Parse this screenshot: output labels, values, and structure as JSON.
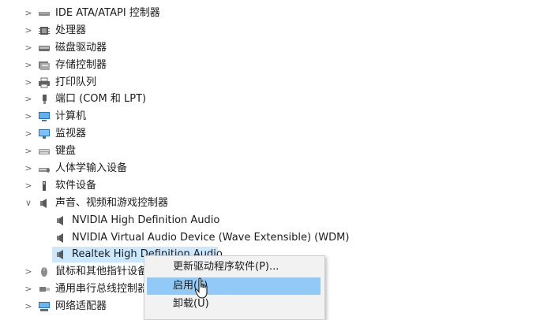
{
  "tree": {
    "items": [
      {
        "label": "IDE ATA/ATAPI 控制器",
        "chevron": ">",
        "icon": "ide-controller-icon",
        "level": 0
      },
      {
        "label": "处理器",
        "chevron": ">",
        "icon": "processor-icon",
        "level": 0
      },
      {
        "label": "磁盘驱动器",
        "chevron": ">",
        "icon": "disk-drive-icon",
        "level": 0
      },
      {
        "label": "存储控制器",
        "chevron": ">",
        "icon": "storage-controller-icon",
        "level": 0
      },
      {
        "label": "打印队列",
        "chevron": ">",
        "icon": "printer-icon",
        "level": 0
      },
      {
        "label": "端口 (COM 和 LPT)",
        "chevron": ">",
        "icon": "port-icon",
        "level": 0
      },
      {
        "label": "计算机",
        "chevron": ">",
        "icon": "computer-icon",
        "level": 0
      },
      {
        "label": "监视器",
        "chevron": ">",
        "icon": "monitor-icon",
        "level": 0
      },
      {
        "label": "键盘",
        "chevron": ">",
        "icon": "keyboard-icon",
        "level": 0
      },
      {
        "label": "人体学输入设备",
        "chevron": ">",
        "icon": "hid-icon",
        "level": 0
      },
      {
        "label": "软件设备",
        "chevron": ">",
        "icon": "software-device-icon",
        "level": 0
      },
      {
        "label": "声音、视频和游戏控制器",
        "chevron": "∨",
        "icon": "speaker-icon",
        "level": 0
      },
      {
        "label": "NVIDIA High Definition Audio",
        "chevron": "",
        "icon": "speaker-icon",
        "level": 1
      },
      {
        "label": "NVIDIA Virtual Audio Device (Wave Extensible) (WDM)",
        "chevron": "",
        "icon": "speaker-icon",
        "level": 1
      },
      {
        "label": "Realtek High Definition Audio",
        "chevron": "",
        "icon": "speaker-icon",
        "level": 1,
        "selected": true
      },
      {
        "label": "鼠标和其他指针设备",
        "chevron": ">",
        "icon": "mouse-icon",
        "level": 0
      },
      {
        "label": "通用串行总线控制器",
        "chevron": ">",
        "icon": "usb-icon",
        "level": 0
      },
      {
        "label": "网络适配器",
        "chevron": ">",
        "icon": "network-adapter-icon",
        "level": 0
      }
    ]
  },
  "context_menu": {
    "items": [
      {
        "label": "更新驱动程序软件(P)..."
      },
      {
        "label": "启用(E)",
        "highlighted": true
      },
      {
        "label": "卸载(U)"
      }
    ]
  },
  "colors": {
    "selection": "#cce8ff",
    "menu_highlight": "#91c9f7",
    "menu_bg": "#f2f2f2"
  }
}
